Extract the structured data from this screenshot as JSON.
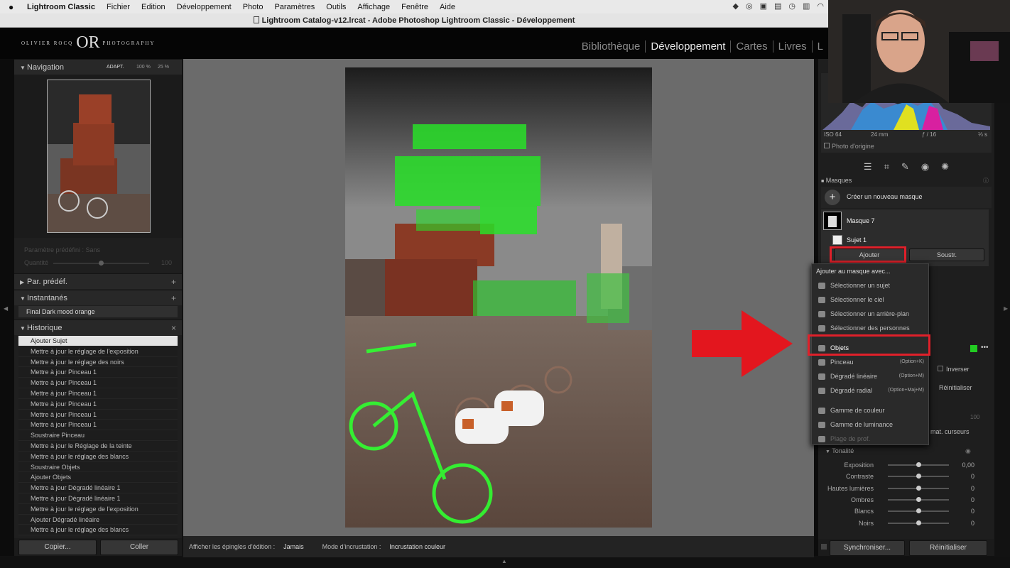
{
  "menubar": {
    "app": "Lightroom Classic",
    "items": [
      "Fichier",
      "Edition",
      "Développement",
      "Photo",
      "Paramètres",
      "Outils",
      "Affichage",
      "Fenêtre",
      "Aide"
    ]
  },
  "window_title": "Lightroom Catalog-v12.lrcat - Adobe Photoshop Lightroom Classic - Développement",
  "logo": {
    "left": "OLIVIER ROCQ",
    "mono": "OR",
    "right": "PHOTOGRAPHY"
  },
  "modules": [
    "Bibliothèque",
    "Développement",
    "Cartes",
    "Livres",
    "L"
  ],
  "navigator": {
    "title": "Navigation",
    "fit": "ADAPT.",
    "zoom1": "100 %",
    "zoom2": "25 %"
  },
  "preset_area": {
    "preset_label": "Paramètre prédéfini : Sans",
    "amount_label": "Quantité",
    "amount_value": "100"
  },
  "panels": {
    "presets": "Par. prédéf.",
    "snapshots": "Instantanés",
    "history": "Historique"
  },
  "snapshot_item": "Final Dark mood orange",
  "history": [
    "Ajouter Sujet",
    "Mettre à jour le réglage de l'exposition",
    "Mettre à jour le réglage des noirs",
    "Mettre à jour Pinceau 1",
    "Mettre à jour Pinceau 1",
    "Mettre à jour Pinceau 1",
    "Mettre à jour Pinceau 1",
    "Mettre à jour Pinceau 1",
    "Mettre à jour Pinceau 1",
    "Soustraire Pinceau",
    "Mettre à jour le Réglage de la teinte",
    "Mettre à jour le réglage des blancs",
    "Soustraire Objets",
    "Ajouter Objets",
    "Mettre à jour Dégradé linéaire 1",
    "Mettre à jour Dégradé linéaire 1",
    "Mettre à jour le réglage de l'exposition",
    "Ajouter Dégradé linéaire",
    "Mettre à jour le réglage des blancs"
  ],
  "left_buttons": {
    "copy": "Copier...",
    "paste": "Coller"
  },
  "toolbar": {
    "pins_label": "Afficher les épingles d'édition :",
    "pins_value": "Jamais",
    "overlay_label": "Mode d'incrustation :",
    "overlay_value": "Incrustation couleur"
  },
  "histogram": {
    "iso": "ISO 64",
    "focal": "24 mm",
    "aperture": "ƒ / 16",
    "shutter": "⅓ s",
    "original": "Photo d'origine"
  },
  "masks": {
    "title": "Masques",
    "create": "Créer un nouveau masque",
    "mask_name": "Masque 7",
    "sub_name": "Sujet 1",
    "add": "Ajouter",
    "subtract": "Soustr."
  },
  "dropdown": {
    "header": "Ajouter au masque avec...",
    "items": [
      {
        "label": "Sélectionner un sujet",
        "shortcut": ""
      },
      {
        "label": "Sélectionner le ciel",
        "shortcut": ""
      },
      {
        "label": "Sélectionner un arrière-plan",
        "shortcut": ""
      },
      {
        "label": "Sélectionner des personnes",
        "shortcut": ""
      },
      {
        "label": "Objets",
        "shortcut": ""
      },
      {
        "label": "Pinceau",
        "shortcut": "(Option+K)"
      },
      {
        "label": "Dégradé linéaire",
        "shortcut": "(Option+M)"
      },
      {
        "label": "Dégradé radial",
        "shortcut": "(Option+Maj+M)"
      },
      {
        "label": "Gamme de couleur",
        "shortcut": ""
      },
      {
        "label": "Gamme de luminance",
        "shortcut": ""
      },
      {
        "label": "Plage de prof.",
        "shortcut": ""
      }
    ]
  },
  "right_panel": {
    "invert": "Inverser",
    "reset": "Réinitialiser",
    "amount_value": "100",
    "auto_reset": "mat. curseurs",
    "tone_title": "Tonalité"
  },
  "tone_sliders": [
    {
      "label": "Exposition",
      "value": "0,00"
    },
    {
      "label": "Contraste",
      "value": "0"
    },
    {
      "label": "Hautes lumières",
      "value": "0"
    },
    {
      "label": "Ombres",
      "value": "0"
    },
    {
      "label": "Blancs",
      "value": "0"
    },
    {
      "label": "Noirs",
      "value": "0"
    }
  ],
  "right_buttons": {
    "sync": "Synchroniser...",
    "reset": "Réinitialiser"
  },
  "colors": {
    "mask_green": "#22e022",
    "highlight_red": "#e0202a",
    "arrow_red": "#e3161e"
  }
}
